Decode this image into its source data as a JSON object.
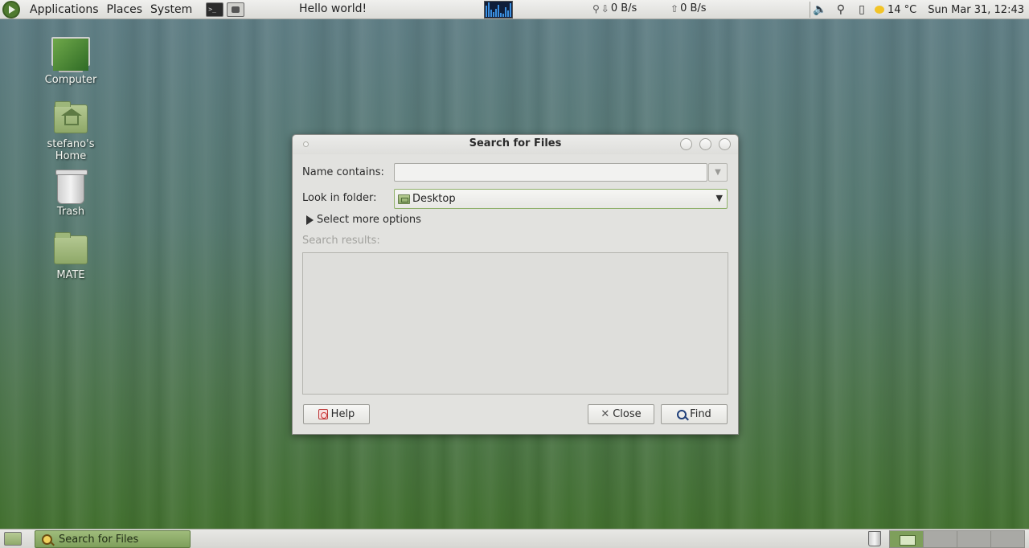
{
  "top_panel": {
    "menus": [
      "Applications",
      "Places",
      "System"
    ],
    "launchers": [
      "terminal-icon",
      "screenshot-icon"
    ],
    "applet_text": "Hello world!",
    "net_down": "0 B/s",
    "net_up": "0 B/s",
    "tray_icons": [
      "volume-icon",
      "network-icon",
      "clipboard-icon"
    ],
    "weather": "14 °C",
    "clock": "Sun Mar 31, 12:43"
  },
  "desktop": {
    "icons": [
      {
        "label": "Computer",
        "icon": "computer-icon"
      },
      {
        "label": "stefano's Home",
        "icon": "home-folder-icon"
      },
      {
        "label": "Trash",
        "icon": "trash-icon"
      },
      {
        "label": "MATE",
        "icon": "folder-icon"
      }
    ]
  },
  "dialog": {
    "title": "Search for Files",
    "name_label": "Name contains:",
    "name_value": "",
    "folder_label": "Look in folder:",
    "folder_value": "Desktop",
    "more_options": "Select more options",
    "results_label": "Search results:",
    "buttons": {
      "help": "Help",
      "close": "Close",
      "find": "Find"
    }
  },
  "bottom_panel": {
    "task_label": "Search for Files",
    "workspaces": 4,
    "active_workspace": 1
  },
  "colors": {
    "accent_green": "#7e9f5b",
    "panel_bg": "#dcdcd8",
    "dialog_bg": "#e2e2df"
  }
}
